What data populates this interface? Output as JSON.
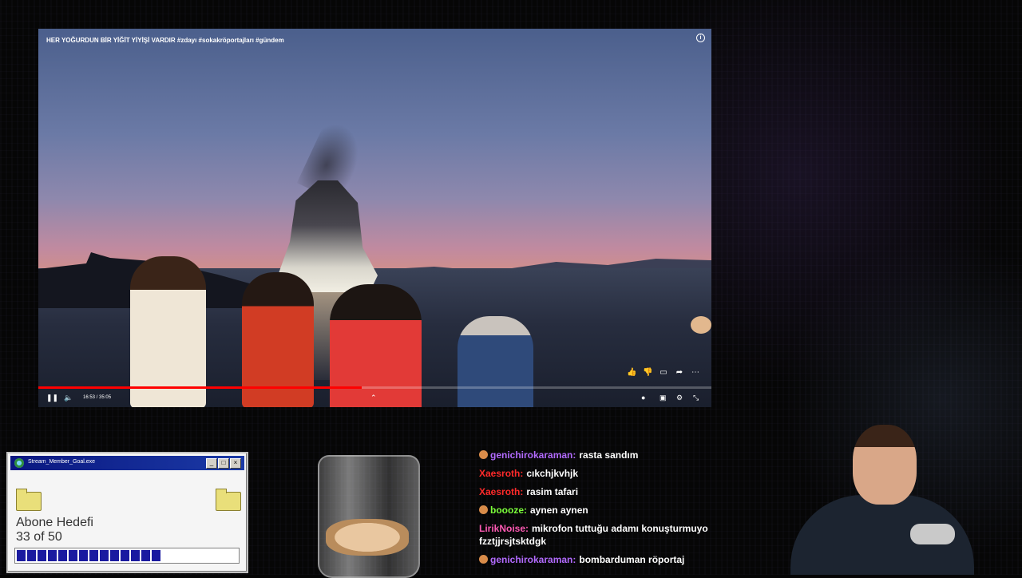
{
  "video": {
    "title": "HER YOĞURDUN BİR YİĞİT YİYİŞİ VARDIR #zdayı #sokakröportajları #gündem",
    "time": "16:53 / 35:05",
    "progress": 0.48
  },
  "goal_window": {
    "title": "Stream_Member_Goal.exe",
    "label": "Abone Hedefi",
    "count": "33 of 50",
    "current": 33,
    "target": 50,
    "minimize": "_",
    "maximize": "□",
    "close": "×"
  },
  "chat": [
    {
      "user": "genichirokaraman:",
      "text": "rasta sandım",
      "color": "#b36bff",
      "badge": true
    },
    {
      "user": "Xaesroth:",
      "text": "cıkchjkvhjk",
      "color": "#ff2a2a",
      "badge": false
    },
    {
      "user": "Xaesroth:",
      "text": "rasim tafari",
      "color": "#ff2a2a",
      "badge": false
    },
    {
      "user": "boooze:",
      "text": "aynen aynen",
      "color": "#7cff3a",
      "badge": true
    },
    {
      "user": "LirikNoise:",
      "text": "mikrofon tuttuğu adamı konuşturmuyo fzztjjrsjtsktdgk",
      "color": "#ff5ab4",
      "badge": false
    },
    {
      "user": "genichirokaraman:",
      "text": "bombarduman röportaj",
      "color": "#b36bff",
      "badge": true
    }
  ]
}
